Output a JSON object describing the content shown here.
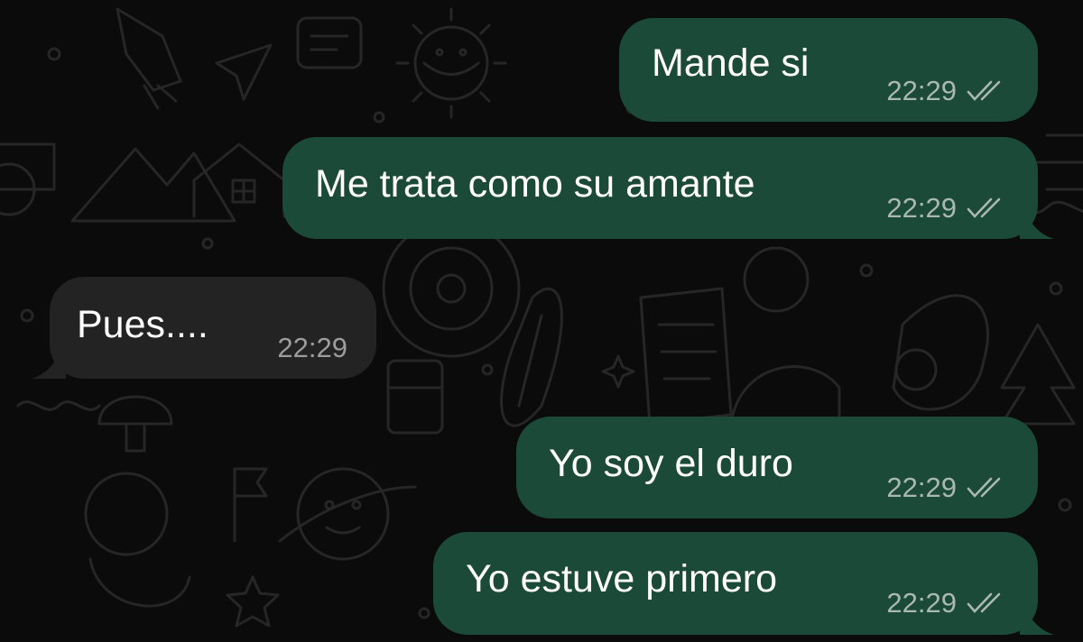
{
  "messages": [
    {
      "direction": "outgoing",
      "text": "Mande si",
      "time": "22:29",
      "status_icon": "double-check-icon"
    },
    {
      "direction": "outgoing",
      "text": "Me trata como su amante",
      "time": "22:29",
      "status_icon": "double-check-icon"
    },
    {
      "direction": "incoming",
      "text": "Pues....",
      "time": "22:29"
    },
    {
      "direction": "outgoing",
      "text": "Yo soy el duro",
      "time": "22:29",
      "status_icon": "double-check-icon"
    },
    {
      "direction": "outgoing",
      "text": "Yo estuve primero",
      "time": "22:29",
      "status_icon": "double-check-icon"
    }
  ],
  "colors": {
    "background": "#0b0b0b",
    "outgoing_bubble": "#1c4a38",
    "incoming_bubble": "#232323",
    "doodle_stroke": "#262626",
    "meta_text": "#a9b8b1"
  }
}
